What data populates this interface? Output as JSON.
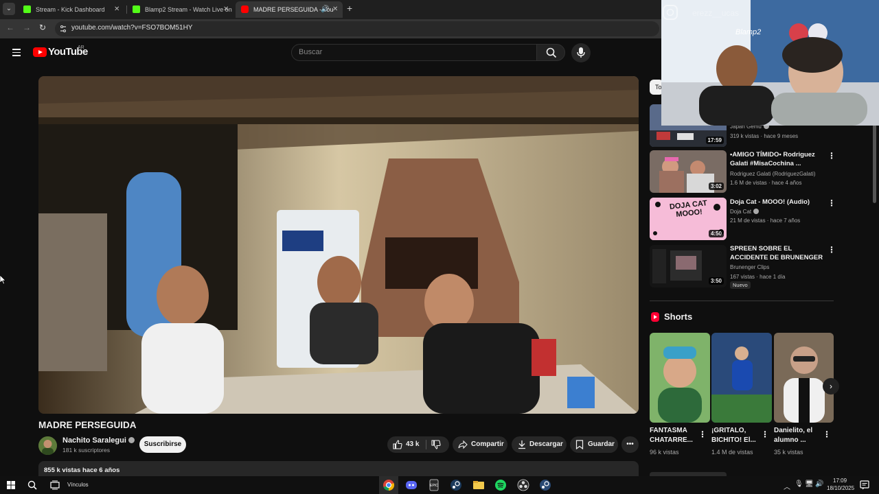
{
  "browser": {
    "tabs": [
      {
        "title": "Stream - Kick Dashboard",
        "favicon": "kick-icon",
        "color": "#53fc18"
      },
      {
        "title": "Blamp2 Stream - Watch Live on",
        "favicon": "kick-icon",
        "color": "#53fc18"
      },
      {
        "title": "MADRE PERSEGUIDA - You",
        "favicon": "youtube-icon",
        "color": "#ff0000",
        "active": true
      }
    ],
    "url": "youtube.com/watch?v=FSO7BOM51HY"
  },
  "youtube": {
    "logo_text": "YouTube",
    "country_code": "AR",
    "search_placeholder": "Buscar"
  },
  "video": {
    "title": "MADRE PERSEGUIDA",
    "channel": "Nachito Saralegui",
    "subscribers": "181 k suscriptores",
    "subscribe_label": "Suscribirse",
    "likes": "43 k",
    "share_label": "Compartir",
    "download_label": "Descargar",
    "save_label": "Guardar",
    "views_date": "855 k vistas  hace 6 años"
  },
  "sidebar": {
    "chip_partial": "To",
    "recommendations": [
      {
        "title": "",
        "channel": "Japan Gemu",
        "meta": "319 k vistas · hace 9 meses",
        "duration": "17:59"
      },
      {
        "title": "•AMIGO TÍMIDO• Rodriguez Galati #MisaCochina ...",
        "channel": "Rodriguez Galati (RodriguezGalati)",
        "meta": "1.6 M de vistas · hace 4 años",
        "duration": "3:02"
      },
      {
        "title": "Doja Cat - MOOO! (Audio)",
        "channel": "Doja Cat",
        "meta": "21 M de vistas · hace 7 años",
        "duration": "4:50",
        "thumb_text": "DOJA CAT MOOO!"
      },
      {
        "title": "SPREEN SOBRE EL ACCIDENTE DE BRUNENGER",
        "channel": "Brunenger Clips",
        "meta": "167 vistas · hace 1 día",
        "duration": "3:50",
        "badge": "Nuevo"
      }
    ],
    "shorts_label": "Shorts",
    "shorts": [
      {
        "title": "FANTASMA CHATARRE...",
        "views": "96 k vistas"
      },
      {
        "title": "¡GRITALO, BICHITO! El...",
        "views": "1.4 M de vistas"
      },
      {
        "title": "Danielito, el alumno ...",
        "views": "35 k vistas"
      }
    ]
  },
  "overlay": {
    "instagram_handle": "erezz__ucas",
    "sign_text": "Blamp2"
  },
  "taskbar": {
    "links_label": "Vínculos",
    "time": "17:09",
    "date": "18/10/2025"
  }
}
